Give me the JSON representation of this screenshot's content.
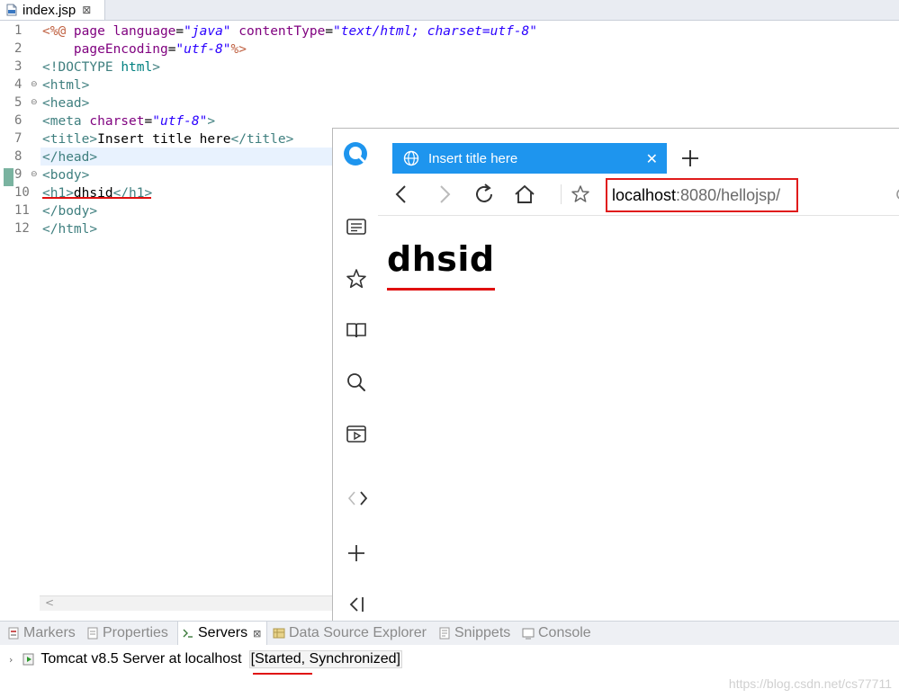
{
  "editor": {
    "file_tab": {
      "title": "index.jsp",
      "close": "⊠"
    },
    "line_numbers": [
      "1",
      "2",
      "3",
      "4",
      "5",
      "6",
      "7",
      "8",
      "9",
      "10",
      "11",
      "12"
    ],
    "lines": [
      [
        {
          "c": "t-dir",
          "t": "<%@ "
        },
        {
          "c": "t-attr",
          "t": "page "
        },
        {
          "c": "t-attr",
          "t": "language"
        },
        {
          "c": "t-text",
          "t": "="
        },
        {
          "c": "t-str",
          "t": "\"java\""
        },
        {
          "c": "t-text",
          "t": " "
        },
        {
          "c": "t-attr",
          "t": "contentType"
        },
        {
          "c": "t-text",
          "t": "="
        },
        {
          "c": "t-str",
          "t": "\"text/html; charset=utf-8\""
        }
      ],
      [
        {
          "c": "t-text",
          "t": "    "
        },
        {
          "c": "t-attr",
          "t": "pageEncoding"
        },
        {
          "c": "t-text",
          "t": "="
        },
        {
          "c": "t-str",
          "t": "\"utf-8\""
        },
        {
          "c": "t-dir",
          "t": "%>"
        }
      ],
      [
        {
          "c": "t-tag",
          "t": "<!"
        },
        {
          "c": "t-doctype",
          "t": "DOCTYPE "
        },
        {
          "c": "t-kw",
          "t": "html"
        },
        {
          "c": "t-tag",
          "t": ">"
        }
      ],
      [
        {
          "c": "t-tag",
          "t": "<html>"
        }
      ],
      [
        {
          "c": "t-tag",
          "t": "<head>"
        }
      ],
      [
        {
          "c": "t-tag",
          "t": "<meta "
        },
        {
          "c": "t-attr",
          "t": "charset"
        },
        {
          "c": "t-text",
          "t": "="
        },
        {
          "c": "t-str",
          "t": "\"utf-8\""
        },
        {
          "c": "t-tag",
          "t": ">"
        }
      ],
      [
        {
          "c": "t-tag",
          "t": "<title>"
        },
        {
          "c": "t-text",
          "t": "Insert title here"
        },
        {
          "c": "t-tag",
          "t": "</title>"
        }
      ],
      [
        {
          "c": "t-tag",
          "t": "</head>"
        }
      ],
      [
        {
          "c": "t-tag",
          "t": "<body>"
        }
      ],
      [
        {
          "c": "t-tag",
          "t": "<h1>"
        },
        {
          "c": "t-text",
          "t": "dhsid"
        },
        {
          "c": "t-tag",
          "t": "</h1>"
        }
      ],
      [
        {
          "c": "t-tag",
          "t": "</body>"
        }
      ],
      [
        {
          "c": "t-tag",
          "t": "</html>"
        }
      ]
    ]
  },
  "browser": {
    "tab_title": "Insert title here",
    "tab_close": "✕",
    "url_host": "localhost",
    "url_rest": ":8080/hellojsp/",
    "page_heading": "dhsid"
  },
  "panel": {
    "tabs": {
      "markers": "Markers",
      "properties": "Properties",
      "servers": "Servers",
      "servers_close": "⊠",
      "data_source": "Data Source Explorer",
      "snippets": "Snippets",
      "console": "Console"
    },
    "server": {
      "name": "Tomcat v8.5 Server at localhost",
      "status": "[Started, Synchronized]"
    }
  },
  "watermark": "https://blog.csdn.net/cs77711",
  "colors": {
    "accent_tab": "#1e95ee",
    "annotation_red": "#e01010"
  }
}
